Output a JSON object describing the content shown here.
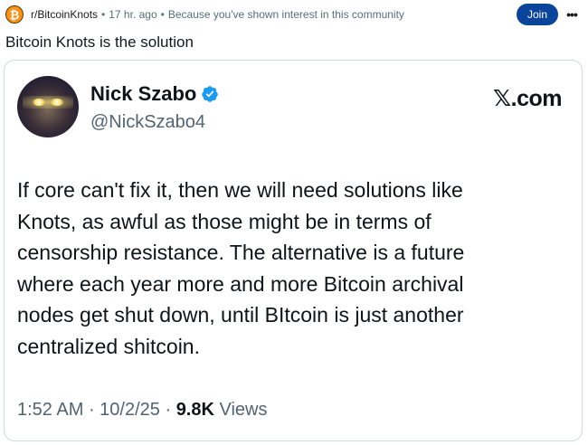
{
  "post": {
    "subreddit": "r/BitcoinKnots",
    "subreddit_icon_glyph": "₿",
    "separator": "•",
    "time_ago": "17 hr. ago",
    "reason": "Because you've shown interest in this community",
    "join_label": "Join",
    "more_label": "•••",
    "title": "Bitcoin Knots is the solution"
  },
  "tweet": {
    "author_name": "Nick Szabo",
    "handle": "@NickSzabo4",
    "source_logo": "𝕏.com",
    "text": "If core can't fix it, then we will need solutions like\nKnots, as awful as those might be in terms of\ncensorship resistance. The alternative is a future\nwhere each year more and more Bitcoin archival\nnodes get shut down,  until BItcoin is just another\ncentralized shitcoin.",
    "time": "1:52 AM",
    "date": "10/2/25",
    "views_count": "9.8K",
    "views_label": "Views"
  },
  "colors": {
    "join_button": "#0a449b",
    "subreddit_icon": "#f7931a",
    "verified_badge": "#1d9bf0"
  }
}
